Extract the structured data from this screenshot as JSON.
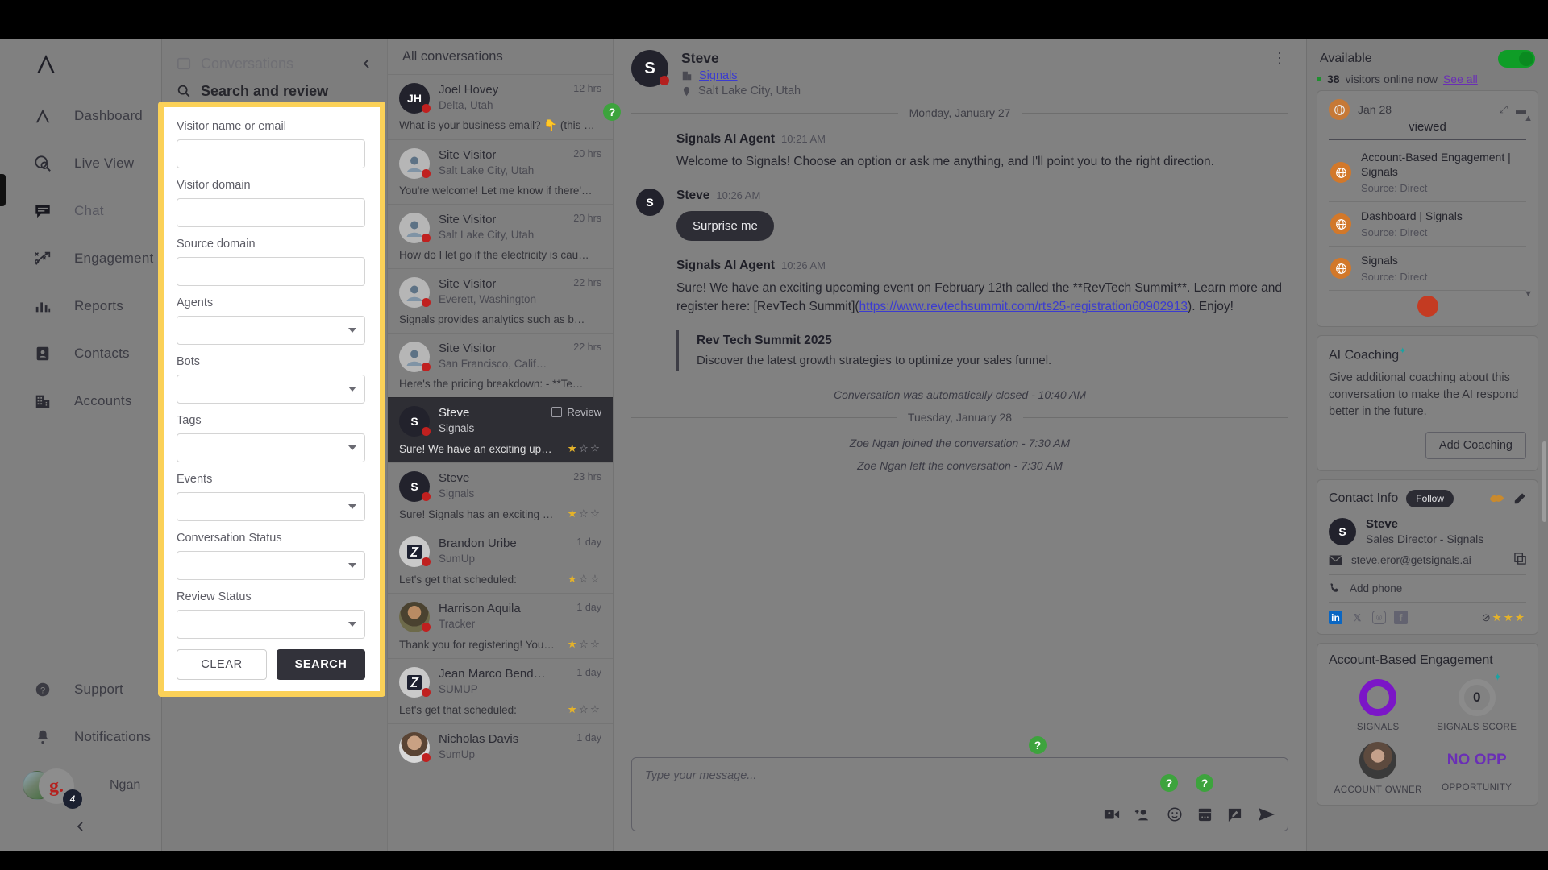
{
  "nav": {
    "items": [
      {
        "label": "Dashboard",
        "icon": "logo-icon"
      },
      {
        "label": "Live View",
        "icon": "live-view-icon"
      },
      {
        "label": "Chat",
        "icon": "chat-icon"
      },
      {
        "label": "Engagement",
        "icon": "engagement-icon"
      },
      {
        "label": "Reports",
        "icon": "reports-icon"
      },
      {
        "label": "Contacts",
        "icon": "contacts-icon"
      },
      {
        "label": "Accounts",
        "icon": "accounts-icon"
      }
    ],
    "bottom": [
      {
        "label": "Support",
        "icon": "help-circle-icon"
      },
      {
        "label": "Notifications",
        "icon": "bell-icon"
      }
    ],
    "user": {
      "name": "Ngan",
      "badge": "4",
      "initial": "g."
    }
  },
  "conversations_panel": {
    "tab_inactive": "Conversations",
    "tab_active": "Search and review"
  },
  "search_form": {
    "fields": [
      {
        "label": "Visitor name or email",
        "type": "text",
        "value": ""
      },
      {
        "label": "Visitor domain",
        "type": "text",
        "value": ""
      },
      {
        "label": "Source domain",
        "type": "text",
        "value": ""
      },
      {
        "label": "Agents",
        "type": "select",
        "value": ""
      },
      {
        "label": "Bots",
        "type": "select",
        "value": ""
      },
      {
        "label": "Tags",
        "type": "select",
        "value": ""
      },
      {
        "label": "Events",
        "type": "select",
        "value": ""
      },
      {
        "label": "Conversation Status",
        "type": "select",
        "value": ""
      },
      {
        "label": "Review Status",
        "type": "select",
        "value": ""
      }
    ],
    "clear_label": "CLEAR",
    "search_label": "SEARCH",
    "highlight_color": "#fbd158"
  },
  "conversation_list": {
    "title": "All conversations",
    "items": [
      {
        "name": "Joel Hovey",
        "org": "Delta, Utah",
        "time": "12 hrs",
        "preview": "What is your business email? 👇 (this …",
        "initials": "JH",
        "avatar": "initials",
        "stars": null,
        "selected": false
      },
      {
        "name": "Site Visitor",
        "org": "Salt Lake City, Utah",
        "time": "20 hrs",
        "preview": "You're welcome! Let me know if there'…",
        "initials": "",
        "avatar": "person",
        "stars": null,
        "selected": false
      },
      {
        "name": "Site Visitor",
        "org": "Salt Lake City, Utah",
        "time": "20 hrs",
        "preview": "How do I let go if the electricity is cau…",
        "initials": "",
        "avatar": "person",
        "stars": null,
        "selected": false
      },
      {
        "name": "Site Visitor",
        "org": "Everett, Washington",
        "time": "22 hrs",
        "preview": "Signals provides analytics such as b…",
        "initials": "",
        "avatar": "person",
        "stars": null,
        "selected": false
      },
      {
        "name": "Site Visitor",
        "org": "San Francisco, Calif…",
        "time": "22 hrs",
        "preview": "Here's the pricing breakdown: - **Te…",
        "initials": "",
        "avatar": "person",
        "stars": null,
        "selected": false
      },
      {
        "name": "Steve",
        "org": "Signals",
        "time": "",
        "review_label": "Review",
        "preview": "Sure! We have an exciting up…",
        "initials": "S",
        "avatar": "initials",
        "stars": 1,
        "selected": true
      },
      {
        "name": "Steve",
        "org": "Signals",
        "time": "23 hrs",
        "preview": "Sure! Signals has an exciting …",
        "initials": "S",
        "avatar": "initials",
        "stars": 1,
        "selected": false
      },
      {
        "name": "Brandon Uribe",
        "org": "SumUp",
        "time": "1 day",
        "preview": "Let's get that scheduled:",
        "initials": "",
        "avatar": "sumup",
        "stars": 1,
        "selected": false
      },
      {
        "name": "Harrison Aquila",
        "org": "Tracker",
        "time": "1 day",
        "preview": "Thank you for registering! You…",
        "initials": "",
        "avatar": "photo-a",
        "stars": 1,
        "selected": false
      },
      {
        "name": "Jean Marco Bend…",
        "org": "SUMUP",
        "time": "1 day",
        "preview": "Let's get that scheduled:",
        "initials": "",
        "avatar": "sumup",
        "stars": 1,
        "selected": false
      },
      {
        "name": "Nicholas Davis",
        "org": "SumUp",
        "time": "1 day",
        "preview": "",
        "initials": "",
        "avatar": "photo-b",
        "stars": null,
        "selected": false
      }
    ]
  },
  "conversation": {
    "header": {
      "name": "Steve",
      "initial": "S",
      "company": "Signals",
      "location": "Salt Lake City, Utah"
    },
    "day1": "Monday, January 27",
    "day2": "Tuesday, January 28",
    "messages": [
      {
        "who": "Signals AI Agent",
        "time": "10:21 AM",
        "text": "Welcome to Signals! Choose an option or ask me anything, and I'll point you to the right direction.",
        "avatar": false
      },
      {
        "who": "Steve",
        "time": "10:26 AM",
        "chip": "Surprise me",
        "avatar": true,
        "initial": "S"
      },
      {
        "who": "Signals AI Agent",
        "time": "10:26 AM",
        "text_pre": "Sure! We have an exciting upcoming event on February 12th called the **RevTech Summit**. Learn more and register here: [RevTech Summit](",
        "link": "https://www.revtechsummit.com/rts25-registration60902913",
        "text_post": "). Enjoy!",
        "quote_title": "Rev Tech Summit 2025",
        "quote_desc": "Discover the latest growth strategies to optimize your sales funnel.",
        "avatar": false
      }
    ],
    "system_lines": [
      "Conversation was automatically closed - 10:40 AM",
      "Zoe Ngan joined the conversation - 7:30 AM",
      "Zoe Ngan left the conversation - 7:30 AM"
    ],
    "composer": {
      "placeholder": "Type your message...",
      "tools": [
        "video-icon",
        "add-person-icon",
        "emoji-icon",
        "calendar-icon",
        "note-icon",
        "send-icon"
      ]
    }
  },
  "right_panel": {
    "availability": {
      "label": "Available",
      "on": true
    },
    "visitors": {
      "count": "38",
      "text": "visitors online now",
      "link": "See all"
    },
    "viewed": {
      "label": "viewed",
      "date_partial": "Jan 28",
      "items": [
        {
          "title": "Account-Based Engagement | Signals",
          "source": "Source: Direct"
        },
        {
          "title": "Dashboard | Signals",
          "source": "Source: Direct"
        },
        {
          "title": "Signals",
          "source": "Source: Direct"
        }
      ]
    },
    "ai_coaching": {
      "title": "AI Coaching",
      "body": "Give additional coaching about this conversation to make the AI respond better in the future.",
      "button": "Add Coaching"
    },
    "contact_info": {
      "title": "Contact Info",
      "follow": "Follow",
      "name": "Steve",
      "initial": "S",
      "role": "Sales Director - Signals",
      "email": "steve.eror@getsignals.ai",
      "phone_placeholder": "Add phone",
      "socials": [
        "linkedin-icon",
        "x-icon",
        "instagram-icon",
        "facebook-icon"
      ],
      "stars": 3
    },
    "abe": {
      "title": "Account-Based Engagement",
      "signals_label": "SIGNALS",
      "score_value": "0",
      "score_label": "SIGNALS SCORE",
      "owner_label": "ACCOUNT OWNER",
      "opportunity_value": "NO OPP",
      "opportunity_label": "OPPORTUNITY"
    }
  }
}
